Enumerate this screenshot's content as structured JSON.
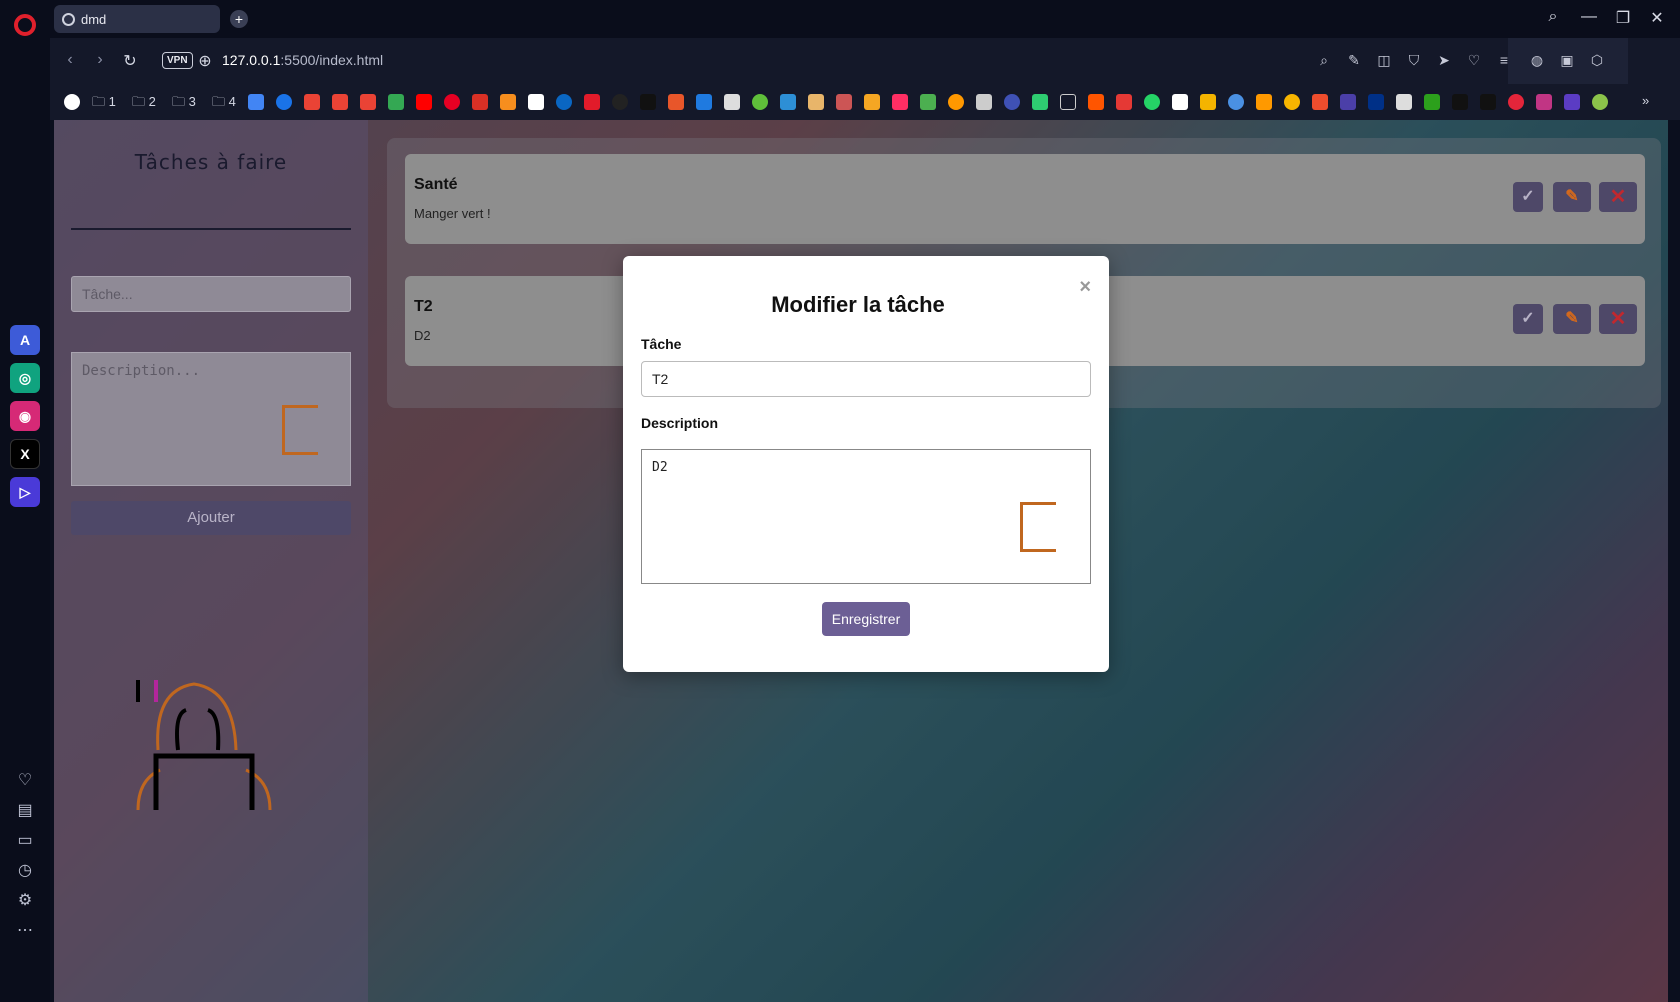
{
  "browser": {
    "tab_title": "dmd",
    "url_host": "127.0.0.1",
    "url_path": ":5500/index.html",
    "vpn_label": "VPN",
    "bookmark_folders": [
      "1",
      "2",
      "3",
      "4"
    ]
  },
  "sidebar": {
    "title": "Tâches à faire",
    "task_placeholder": "Tâche...",
    "description_placeholder": "Description...",
    "add_button": "Ajouter"
  },
  "tasks": [
    {
      "title": "Santé",
      "description": "Manger vert !"
    },
    {
      "title": "T2",
      "description": "D2"
    }
  ],
  "actions": {
    "check": "✓",
    "edit": "✎",
    "delete": "✕"
  },
  "modal": {
    "title": "Modifier la tâche",
    "close": "×",
    "task_label": "Tâche",
    "task_value": "T2",
    "description_label": "Description",
    "description_value": "D2",
    "save_button": "Enregistrer"
  },
  "colors": {
    "accent": "#6c5f95",
    "button_dark": "#4e4868",
    "edit_icon": "#d4691c",
    "delete_icon": "#c1282e",
    "deco_orange": "#c0671f"
  }
}
